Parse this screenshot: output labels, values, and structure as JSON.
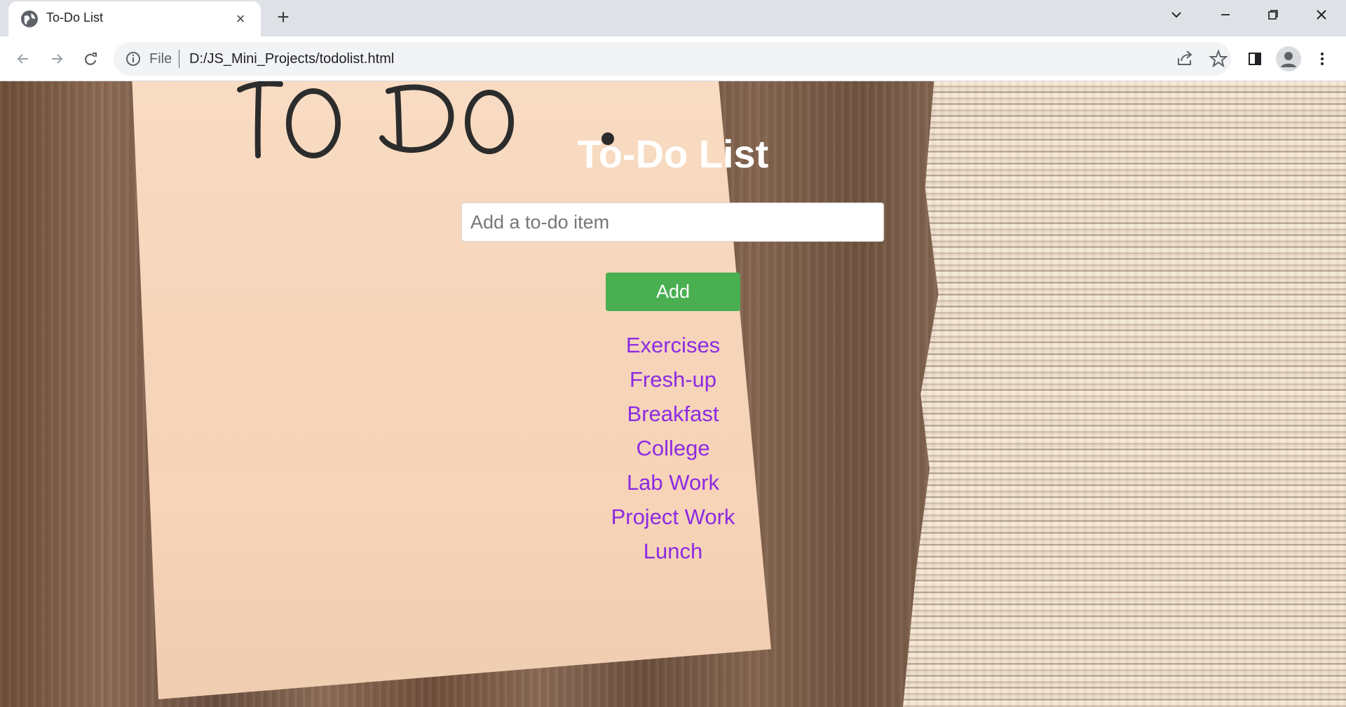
{
  "browser": {
    "tab_title": "To-Do List",
    "address_scheme_label": "File",
    "address_url": "D:/JS_Mini_Projects/todolist.html"
  },
  "app": {
    "note_heading": "To Do.",
    "title": "To-Do List",
    "input_placeholder": "Add a to-do item",
    "add_button_label": "Add",
    "items": [
      "Exercises",
      "Fresh-up",
      "Breakfast",
      "College",
      "Lab Work",
      "Project Work",
      "Lunch"
    ]
  },
  "icons": {
    "tab_favicon": "globe-icon",
    "tab_close": "close-icon",
    "new_tab": "plus-icon",
    "tab_search": "chevron-down-icon",
    "minimize": "minimize-icon",
    "restore": "restore-icon",
    "close_window": "close-icon",
    "back": "arrow-left-icon",
    "forward": "arrow-right-icon",
    "reload": "reload-icon",
    "site_info": "info-icon",
    "share": "share-icon",
    "bookmark": "star-icon",
    "side_panel": "side-panel-icon",
    "profile": "profile-icon",
    "menu": "more-vertical-icon"
  },
  "colors": {
    "add_button": "#49af50",
    "item_text": "#8c2be2",
    "title_text": "#ffffff"
  }
}
